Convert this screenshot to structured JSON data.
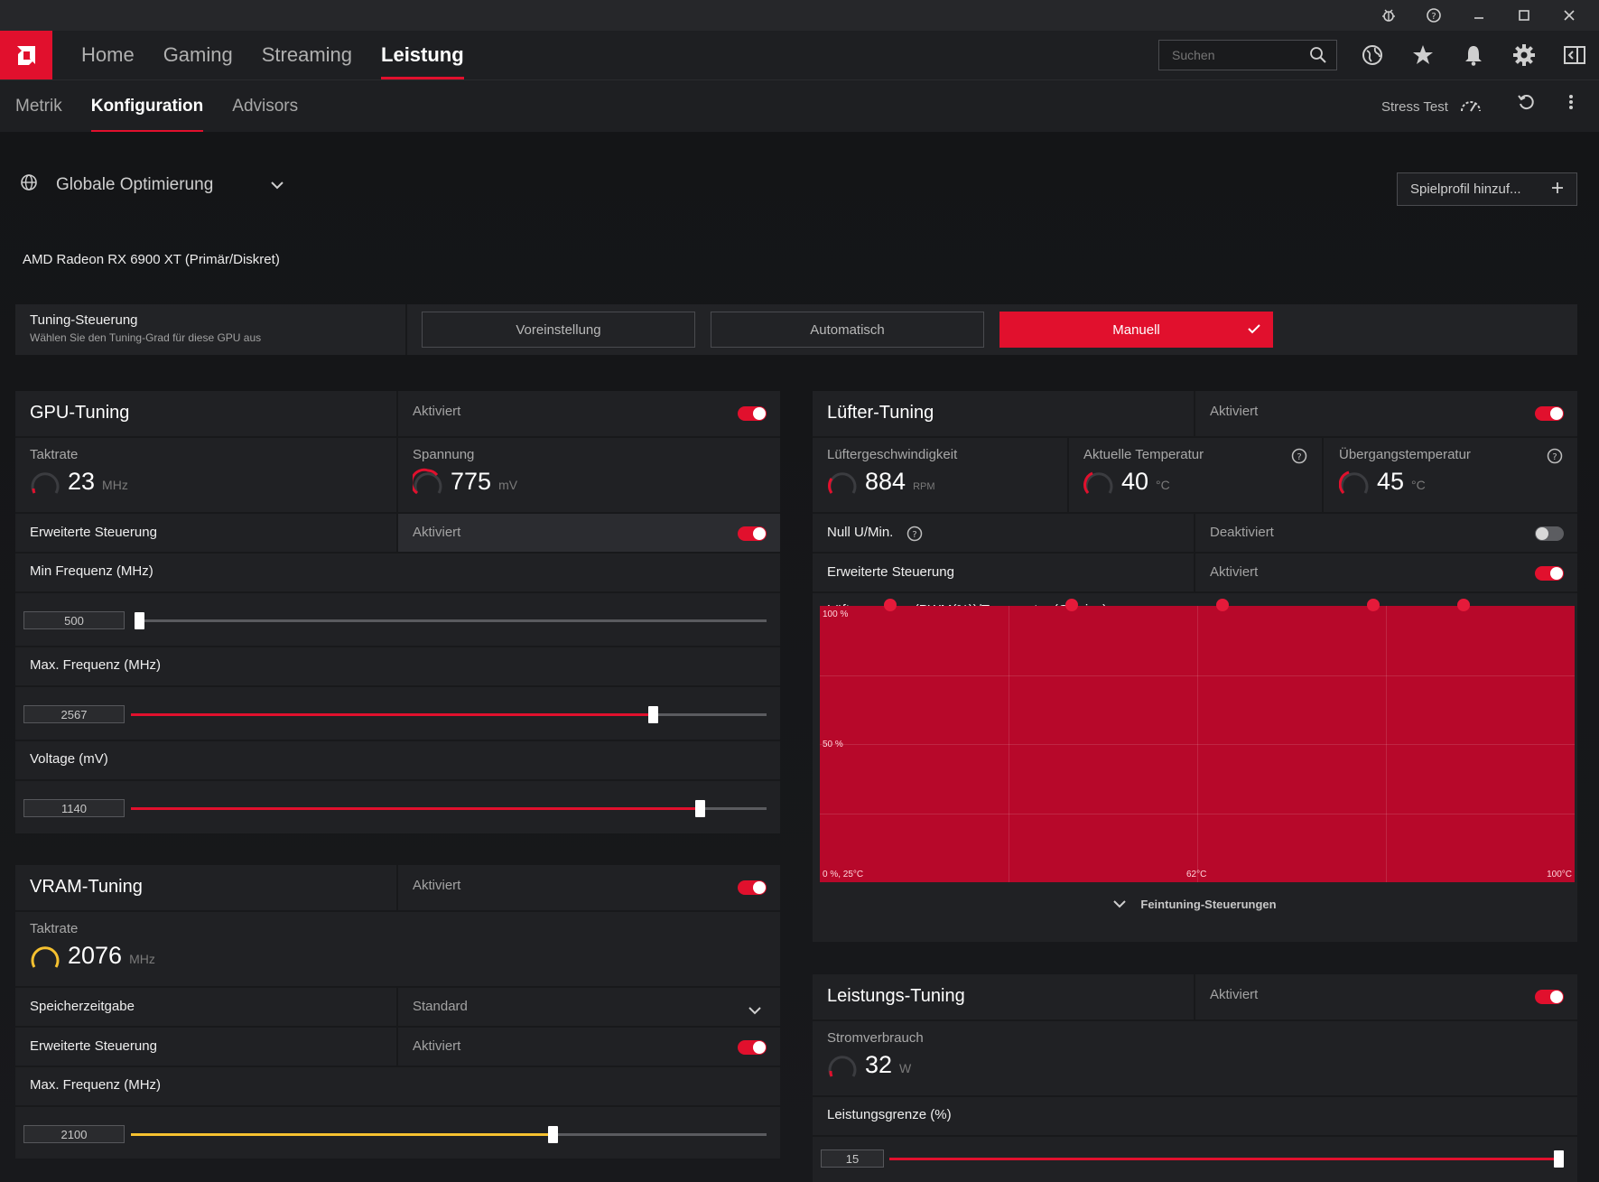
{
  "titlebar": {
    "icons": [
      "bug-icon",
      "help-icon",
      "minimize-icon",
      "maximize-icon",
      "close-icon"
    ]
  },
  "nav": {
    "tabs": [
      "Home",
      "Gaming",
      "Streaming",
      "Leistung"
    ],
    "active_tab": "Leistung",
    "search_placeholder": "Suchen",
    "icons": [
      "globe-icon",
      "star-icon",
      "bell-icon",
      "gear-icon",
      "sidebar-icon"
    ]
  },
  "subnav": {
    "tabs": [
      "Metrik",
      "Konfiguration",
      "Advisors"
    ],
    "active_tab": "Konfiguration",
    "stress_test": "Stress Test"
  },
  "profile": {
    "name": "Globale Optimierung",
    "add_profile": "Spielprofil hinzuf..."
  },
  "gpu_name": "AMD Radeon RX 6900 XT (Primär/Diskret)",
  "tuning": {
    "title": "Tuning-Steuerung",
    "subtitle": "Wählen Sie den Tuning-Grad für diese GPU aus",
    "options": [
      "Voreinstellung",
      "Automatisch",
      "Manuell"
    ],
    "selected": "Manuell"
  },
  "gpu_tuning": {
    "title": "GPU-Tuning",
    "status": "Aktiviert",
    "enabled": true,
    "clock": {
      "label": "Taktrate",
      "value": "23",
      "unit": "MHz"
    },
    "voltage": {
      "label": "Spannung",
      "value": "775",
      "unit": "mV"
    },
    "advanced": {
      "label": "Erweiterte Steuerung",
      "status": "Aktiviert",
      "enabled": true
    },
    "min_freq": {
      "label": "Min Frequenz (MHz)",
      "value": "500",
      "fraction": 0.0
    },
    "max_freq": {
      "label": "Max. Frequenz (MHz)",
      "value": "2567",
      "fraction": 0.82
    },
    "voltage_mv": {
      "label": "Voltage (mV)",
      "value": "1140",
      "fraction": 0.895
    }
  },
  "vram_tuning": {
    "title": "VRAM-Tuning",
    "status": "Aktiviert",
    "enabled": true,
    "clock": {
      "label": "Taktrate",
      "value": "2076",
      "unit": "MHz"
    },
    "timing": {
      "label": "Speicherzeitgabe",
      "value": "Standard"
    },
    "advanced": {
      "label": "Erweiterte Steuerung",
      "status": "Aktiviert",
      "enabled": true
    },
    "max_freq": {
      "label": "Max. Frequenz (MHz)",
      "value": "2100",
      "fraction": 0.663
    }
  },
  "fan_tuning": {
    "title": "Lüfter-Tuning",
    "status": "Aktiviert",
    "enabled": true,
    "fan_speed": {
      "label": "Lüftergeschwindigkeit",
      "value": "884",
      "unit": "RPM"
    },
    "current_temp": {
      "label": "Aktuelle Temperatur",
      "value": "40",
      "unit": "°C"
    },
    "junction_temp": {
      "label": "Übergangstemperatur",
      "value": "45",
      "unit": "°C"
    },
    "zero_rpm": {
      "label": "Null U/Min.",
      "status": "Deaktiviert",
      "enabled": false
    },
    "advanced": {
      "label": "Erweiterte Steuerung",
      "status": "Aktiviert",
      "enabled": true
    },
    "curve_label": "Lüftergeschw. (PWM(%))/Temperatur (Celsius)",
    "finetune": "Feintuning-Steuerungen"
  },
  "chart_data": {
    "type": "line",
    "x_labels": [
      "25°C",
      "62°C",
      "100°C"
    ],
    "y_labels": [
      "100 %",
      "50 %",
      "0 %"
    ],
    "bottom_left_label": "0 %, 25°C",
    "xlim": [
      25,
      100
    ],
    "ylim": [
      0,
      100
    ],
    "points": [
      {
        "x": 32,
        "y": 100
      },
      {
        "x": 50,
        "y": 100
      },
      {
        "x": 65,
        "y": 100
      },
      {
        "x": 80,
        "y": 100
      },
      {
        "x": 89,
        "y": 100
      }
    ]
  },
  "power_tuning": {
    "title": "Leistungs-Tuning",
    "status": "Aktiviert",
    "enabled": true,
    "power": {
      "label": "Stromverbrauch",
      "value": "32",
      "unit": "W"
    },
    "limit": {
      "label": "Leistungsgrenze (%)",
      "value": "15",
      "fraction": 1.0
    }
  },
  "colors": {
    "accent": "#e1102d",
    "vram_accent": "#f5c130",
    "background": "#161719",
    "panel": "#202124"
  }
}
